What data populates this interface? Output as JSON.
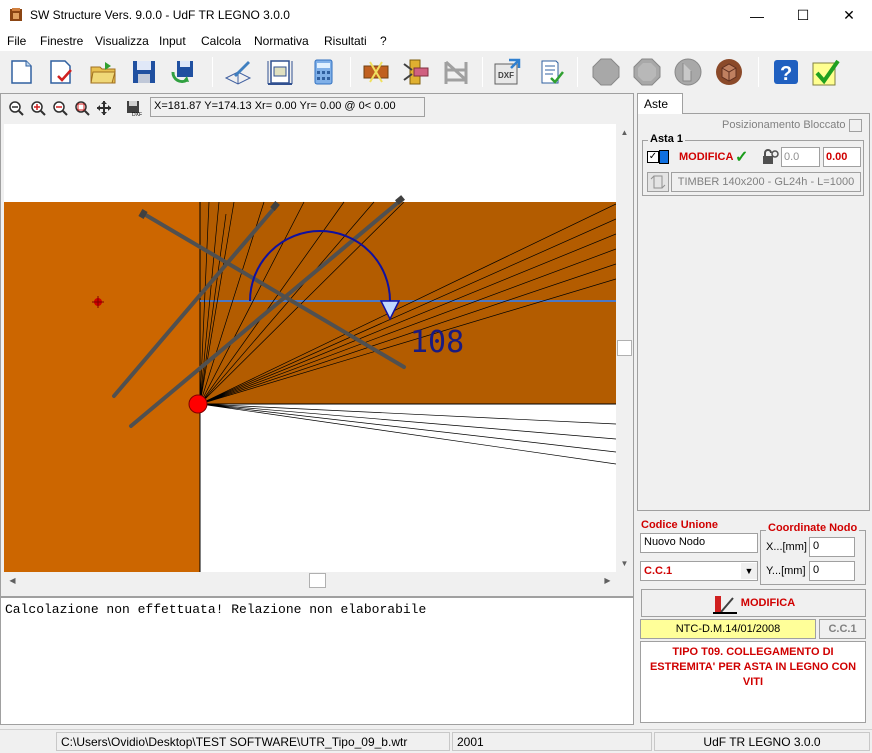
{
  "window": {
    "title": "SW Structure Vers. 9.0.0 - UdF TR LEGNO 3.0.0",
    "minimize": "—",
    "maximize": "☐",
    "close": "✕"
  },
  "menu": [
    "File",
    "Finestre",
    "Visualizza",
    "Input",
    "Calcola",
    "Normativa",
    "Risultati",
    "?"
  ],
  "toolbar_icons": [
    "new-icon",
    "edit-check-icon",
    "open-folder-icon",
    "save-icon",
    "save-refresh-icon",
    "book-pen-icon",
    "scale-icon",
    "calculator-icon",
    "beam-icon",
    "connection-icon",
    "frame-icon",
    "dxf-export-icon",
    "report-check-icon",
    "stop-icon",
    "octagon-icon",
    "cut-icon",
    "box-icon",
    "help-icon",
    "verify-icon"
  ],
  "view": {
    "coords": "X=181.87 Y=174.13 Xr= 0.00 Yr= 0.00 @  0< 0.00",
    "angle_label": "108"
  },
  "message": "Calcolazione non effettuata! Relazione non elaborabile",
  "panel": {
    "tab": "Aste",
    "blocked_label": "Posizionamento Bloccato",
    "asta": {
      "title": "Asta 1",
      "check": "✓",
      "modify_label": "MODIFICA",
      "ok": "✓",
      "value1": "0.0",
      "value2": "0.00",
      "description": "TIMBER 140x200 - GL24h - L=1000",
      "color": "#1070e0"
    },
    "codice_unione_label": "Codice Unione",
    "codice_unione_value": "Nuovo Nodo",
    "cc_select": "C.C.1",
    "coord_label": "Coordinate Nodo",
    "x_label": "X...[mm]",
    "x_value": "0",
    "y_label": "Y...[mm]",
    "y_value": "0",
    "modify_button": "MODIFICA",
    "norm": "NTC-D.M.14/01/2008",
    "cc_code": "C.C.1",
    "tipo": "TIPO T09. COLLEGAMENTO DI ESTREMITA' PER ASTA IN LEGNO CON VITI"
  },
  "status": {
    "path": "C:\\Users\\Ovidio\\Desktop\\TEST SOFTWARE\\UTR_Tipo_09_b.wtr",
    "code": "2001",
    "product": "UdF TR LEGNO 3.0.0"
  },
  "colors": {
    "column_wood": "#cc6600",
    "beam_wood": "#b35c00",
    "screw": "#505050",
    "axis": "#4a78c8",
    "node": "#ff0000"
  }
}
